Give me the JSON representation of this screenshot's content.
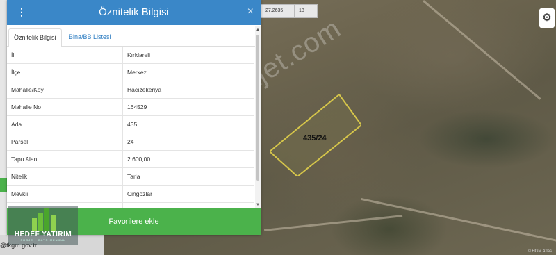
{
  "panel": {
    "title": "Öznitelik Bilgisi",
    "close_label": "×",
    "menu_label": "⋮",
    "tabs": [
      {
        "label": "Öznitelik Bilgisi"
      },
      {
        "label": "Bina/BB Listesi"
      }
    ],
    "rows": [
      {
        "key": "İl",
        "value": "Kırklareli"
      },
      {
        "key": "İlçe",
        "value": "Merkez"
      },
      {
        "key": "Mahalle/Köy",
        "value": "Hacızekeriya"
      },
      {
        "key": "Mahalle No",
        "value": "164529"
      },
      {
        "key": "Ada",
        "value": "435"
      },
      {
        "key": "Parsel",
        "value": "24"
      },
      {
        "key": "Tapu Alanı",
        "value": "2.600,00"
      },
      {
        "key": "Nitelik",
        "value": "Tarla"
      },
      {
        "key": "Mevkii",
        "value": "Cingozlar"
      },
      {
        "key": "",
        "value": ""
      }
    ],
    "favorite_button": "Favorilere ekle"
  },
  "map": {
    "coord_readout": "27.2635",
    "zoom_readout": "18",
    "parcel_label": "435/24",
    "watermark": "emlakjet.com",
    "attribution": "© HGM Atlas",
    "email_fragment": "@tkgm.gov.tr",
    "settings_icon": "gear-icon"
  },
  "logo": {
    "name": "HEDEF YATIRIM",
    "tagline": "PROJE · GAYRİMENKUL"
  },
  "colors": {
    "header": "#3a87c8",
    "button": "#4bb24b",
    "parcel_outline": "#d6c64a"
  }
}
